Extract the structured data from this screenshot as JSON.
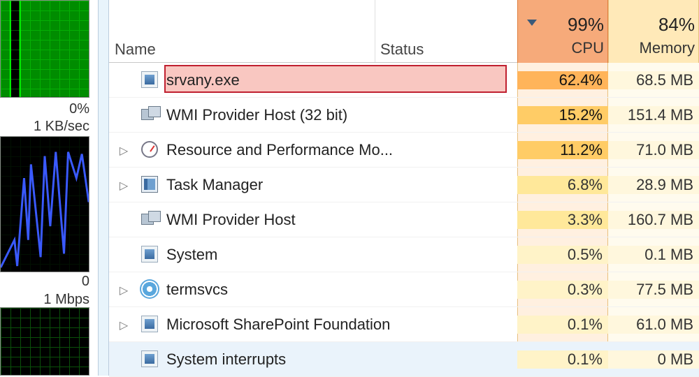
{
  "sidebar": {
    "cpu_label": "0%",
    "net_label": "1 KB/sec",
    "disk_zero": "0",
    "disk_label": "1 Mbps"
  },
  "columns": {
    "name": "Name",
    "status": "Status",
    "cpu_title": "CPU",
    "mem_title": "Memory",
    "cpu_total": "99%",
    "mem_total": "84%"
  },
  "highlight_row_index": 0,
  "selected_row_index": 8,
  "processes": [
    {
      "name": "srvany.exe",
      "cpu": "62.4%",
      "heat": "heat-hi",
      "mem": "68.5 MB",
      "icon": "ic-app",
      "expandable": false
    },
    {
      "name": "WMI Provider Host (32 bit)",
      "cpu": "15.2%",
      "heat": "heat-mid",
      "mem": "151.4 MB",
      "icon": "ic-host",
      "expandable": false
    },
    {
      "name": "Resource and Performance Mo...",
      "cpu": "11.2%",
      "heat": "heat-mid",
      "mem": "71.0 MB",
      "icon": "ic-gauge",
      "expandable": true
    },
    {
      "name": "Task Manager",
      "cpu": "6.8%",
      "heat": "heat-lo",
      "mem": "28.9 MB",
      "icon": "ic-mon",
      "expandable": true
    },
    {
      "name": "WMI Provider Host",
      "cpu": "3.3%",
      "heat": "heat-lo",
      "mem": "160.7 MB",
      "icon": "ic-host",
      "expandable": false
    },
    {
      "name": "System",
      "cpu": "0.5%",
      "heat": "heat-vlo",
      "mem": "0.1 MB",
      "icon": "ic-app",
      "expandable": false
    },
    {
      "name": "termsvcs",
      "cpu": "0.3%",
      "heat": "heat-vlo",
      "mem": "77.5 MB",
      "icon": "ic-gear",
      "expandable": true
    },
    {
      "name": "Microsoft SharePoint Foundation",
      "cpu": "0.1%",
      "heat": "heat-vlo",
      "mem": "61.0 MB",
      "icon": "ic-app",
      "expandable": true
    },
    {
      "name": "System interrupts",
      "cpu": "0.1%",
      "heat": "heat-vlo",
      "mem": "0 MB",
      "icon": "ic-app",
      "expandable": false
    }
  ]
}
